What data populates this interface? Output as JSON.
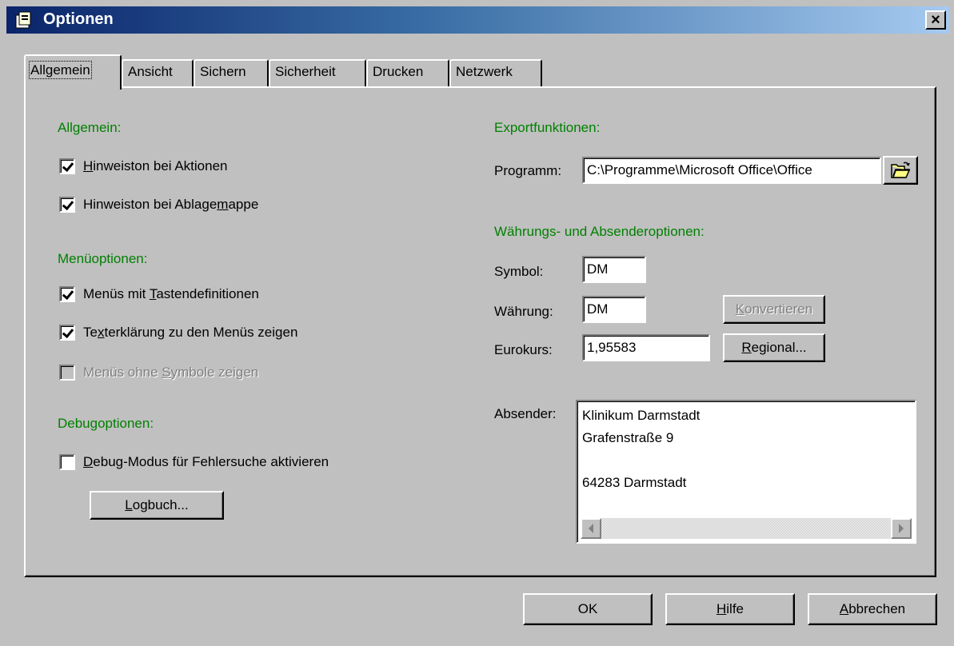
{
  "window": {
    "title": "Optionen",
    "close_label": "×"
  },
  "tabs": [
    {
      "label": "Allgemein",
      "active": true
    },
    {
      "label": "Ansicht"
    },
    {
      "label": "Sichern"
    },
    {
      "label": "Sicherheit"
    },
    {
      "label": "Drucken"
    },
    {
      "label": "Netzwerk"
    }
  ],
  "left": {
    "allgemein": {
      "heading": "Allgemein:",
      "items": [
        {
          "pre": "",
          "key": "H",
          "post": "inweiston bei Aktionen",
          "checked": true
        },
        {
          "pre": "Hinweiston bei Ablage",
          "key": "m",
          "post": "appe",
          "checked": true
        }
      ]
    },
    "menue": {
      "heading": "Menüoptionen:",
      "items": [
        {
          "pre": "Menüs mit ",
          "key": "T",
          "post": "astendefinitionen",
          "checked": true
        },
        {
          "pre": "Te",
          "key": "x",
          "post": "terklärung zu den Menüs zeigen",
          "checked": true
        },
        {
          "pre": "Menüs ohne ",
          "key": "S",
          "post": "ymbole zeigen",
          "checked": false,
          "disabled": true
        }
      ]
    },
    "debug": {
      "heading": "Debugoptionen:",
      "item": {
        "pre": "",
        "key": "D",
        "post": "ebug-Modus für Fehlersuche aktivieren",
        "checked": false
      },
      "logbuch": {
        "key": "L",
        "post": "ogbuch..."
      }
    }
  },
  "right": {
    "export": {
      "heading": "Exportfunktionen:",
      "programm_label": "Programm:",
      "programm_value": "C:\\Programme\\Microsoft Office\\Office"
    },
    "currency": {
      "heading": "Währungs- und Absenderoptionen:",
      "symbol_label": "Symbol:",
      "symbol_value": "DM",
      "waehrung_label": "Währung:",
      "waehrung_value": "DM",
      "konvertieren": {
        "key": "K",
        "post": "onvertieren"
      },
      "eurokurs_label": "Eurokurs:",
      "eurokurs_value": "1,95583",
      "regional": {
        "key": "R",
        "post": "egional..."
      }
    },
    "absender": {
      "label": "Absender:",
      "lines": [
        "Klinikum Darmstadt",
        "Grafenstraße 9",
        "",
        "64283 Darmstadt"
      ]
    }
  },
  "footer": {
    "ok": "OK",
    "hilfe": {
      "key": "H",
      "post": "ilfe"
    },
    "abbrechen": {
      "key": "A",
      "post": "bbrechen"
    }
  }
}
